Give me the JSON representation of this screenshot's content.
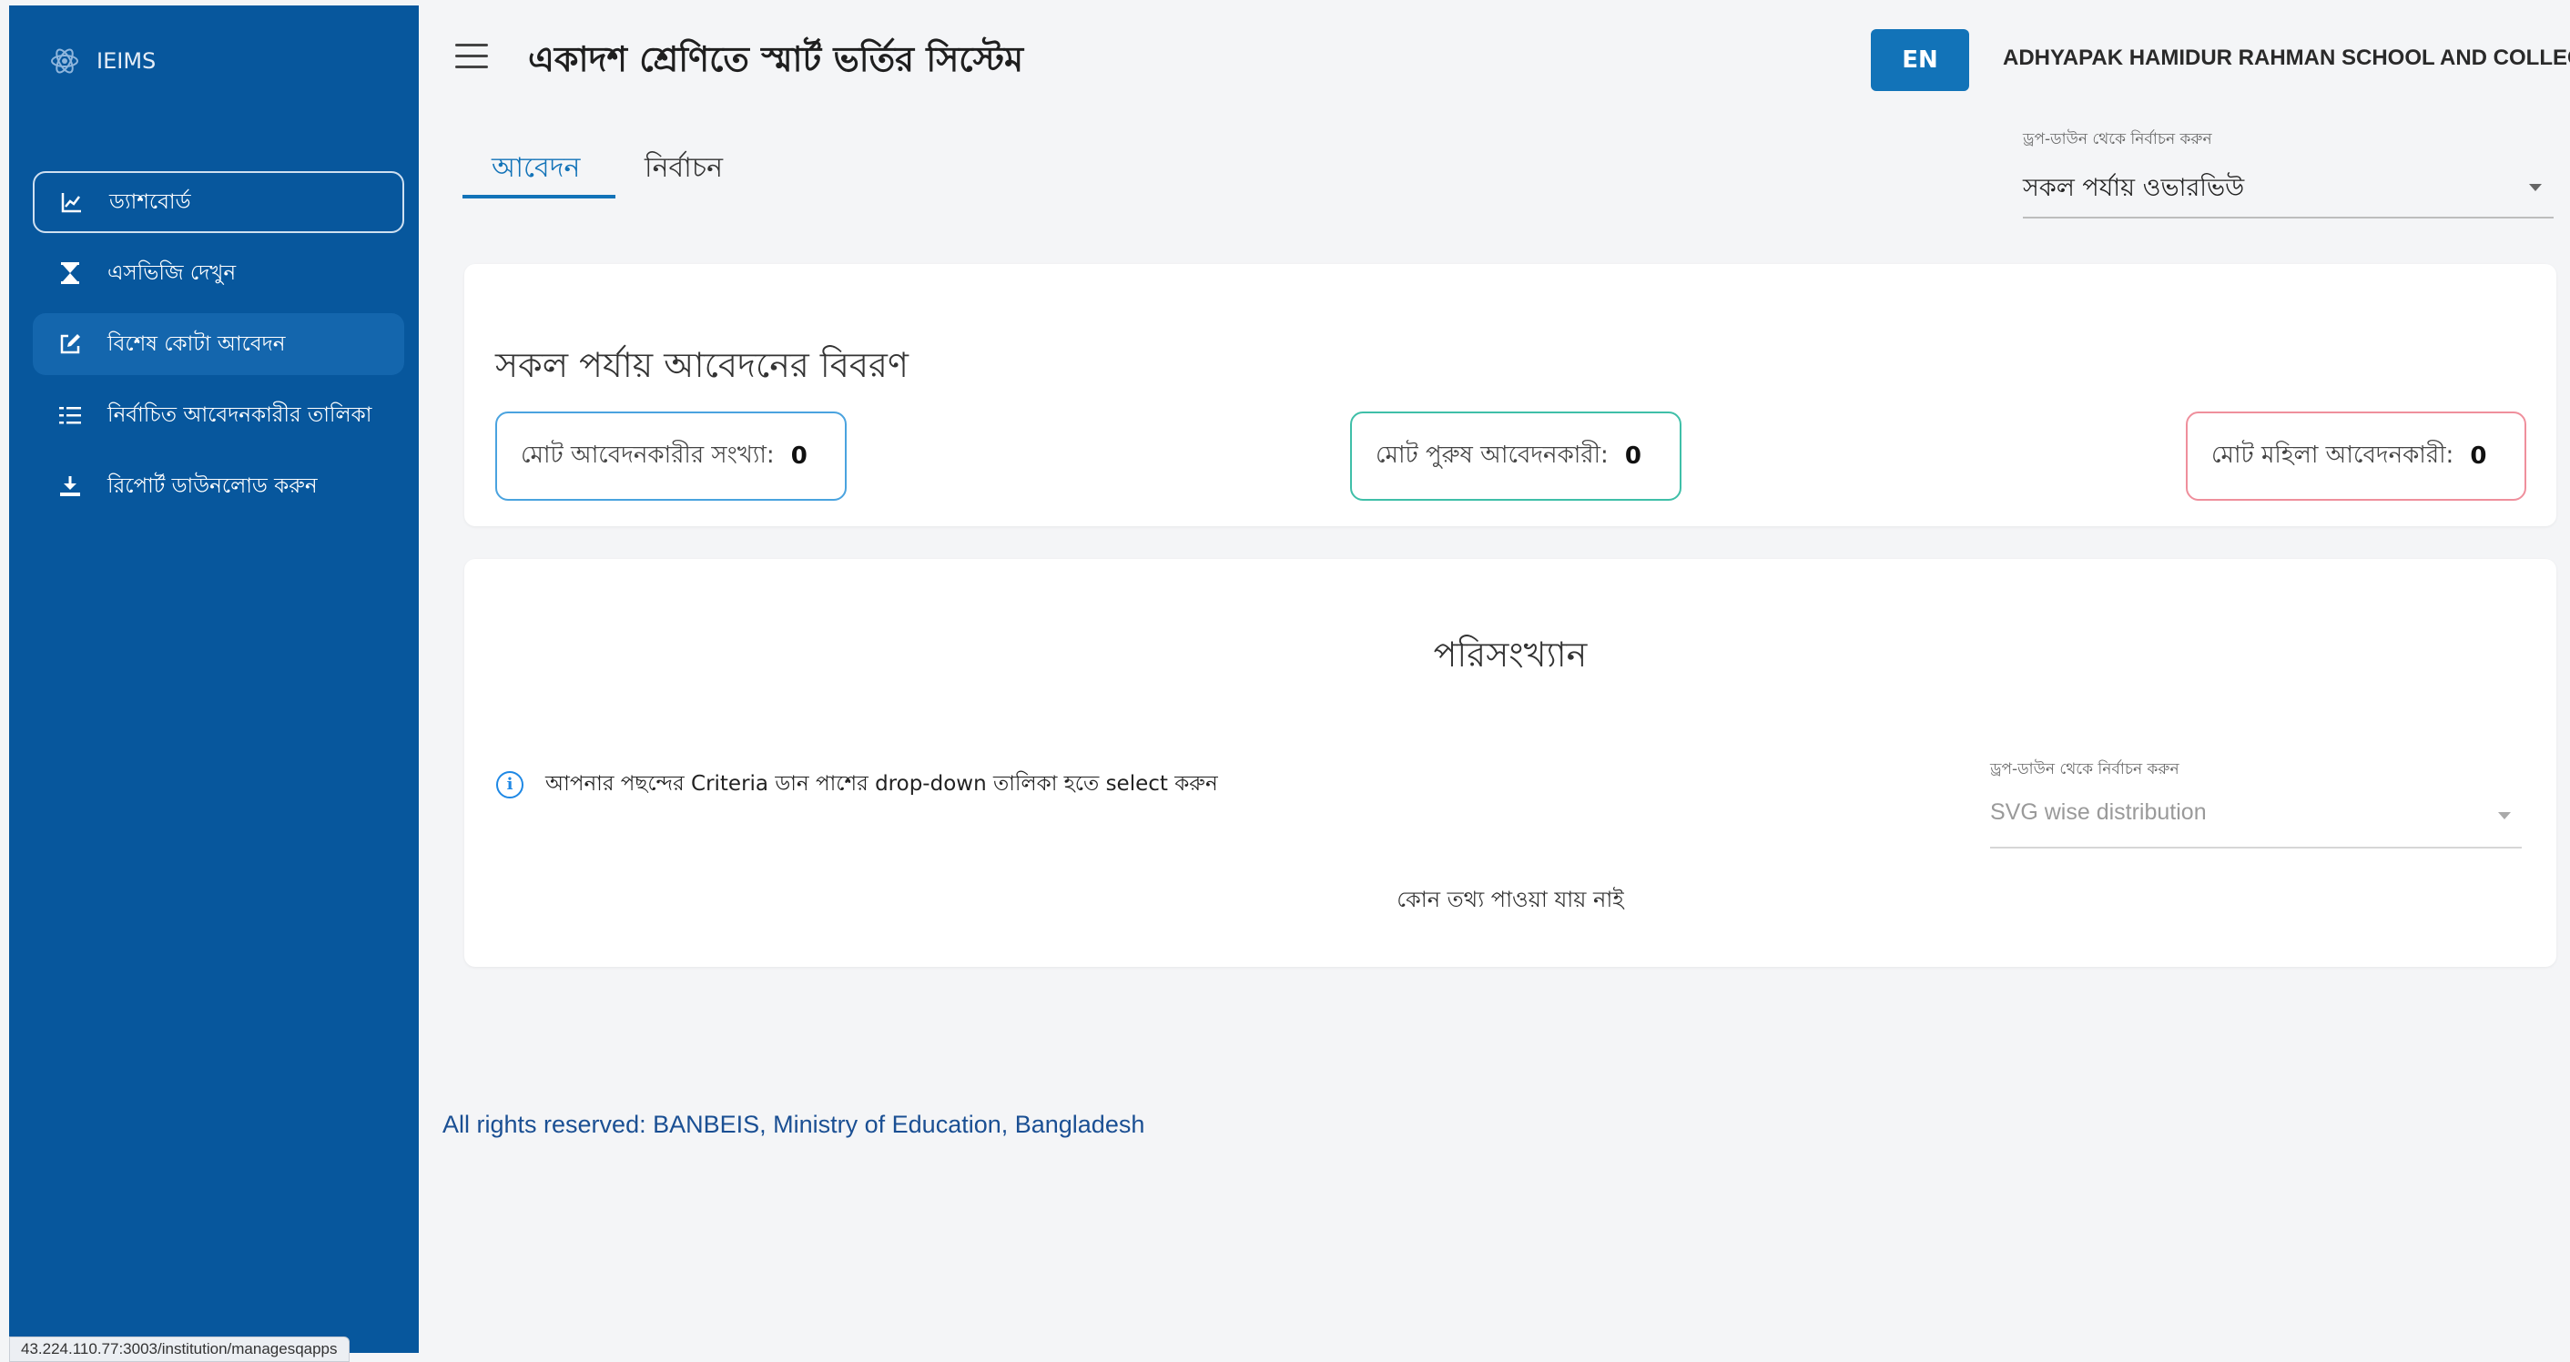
{
  "sidebar": {
    "brand": "IEIMS",
    "items": [
      {
        "label": "ড্যাশবোর্ড",
        "icon": "chart-line-icon"
      },
      {
        "label": "এসভিজি দেখুন",
        "icon": "hourglass-icon"
      },
      {
        "label": "বিশেষ কোটা আবেদন",
        "icon": "edit-icon"
      },
      {
        "label": "নির্বাচিত আবেদনকারীর তালিকা",
        "icon": "list-icon"
      },
      {
        "label": "রিপোর্ট ডাউনলোড করুন",
        "icon": "download-icon"
      }
    ]
  },
  "status_url": "43.224.110.77:3003/institution/managesqapps",
  "header": {
    "title": "একাদশ শ্রেণিতে স্মার্ট ভর্তির সিস্টেম",
    "lang_button": "EN",
    "institution": "ADHYAPAK HAMIDUR RAHMAN SCHOOL AND COLLEGE"
  },
  "tabs": [
    {
      "label": "আবেদন",
      "active": true
    },
    {
      "label": "নির্বাচন",
      "active": false
    }
  ],
  "phase_select": {
    "label": "ড্রপ-ডাউন থেকে নির্বাচন করুন",
    "value": "সকল পর্যায় ওভারভিউ"
  },
  "summary": {
    "title": "সকল পর্যায় আবেদনের বিবরণ",
    "stats": [
      {
        "label": "মোট আবেদনকারীর সংখ্যা:",
        "value": "0",
        "color": "#4aa3df"
      },
      {
        "label": "মোট পুরুষ আবেদনকারী:",
        "value": "0",
        "color": "#3fbfa8"
      },
      {
        "label": "মোট মহিলা আবেদনকারী:",
        "value": "0",
        "color": "#ef8f9c"
      }
    ]
  },
  "statistics": {
    "title": "পরিসংখ্যান",
    "info": "আপনার পছন্দের Criteria ডান পাশের drop-down তালিকা হতে select করুন",
    "select_label": "ড্রপ-ডাউন থেকে নির্বাচন করুন",
    "select_placeholder": "SVG wise distribution",
    "empty": "কোন তথ্য পাওয়া যায় নাই"
  },
  "footer": "All rights reserved: BANBEIS, Ministry of Education, Bangladesh"
}
